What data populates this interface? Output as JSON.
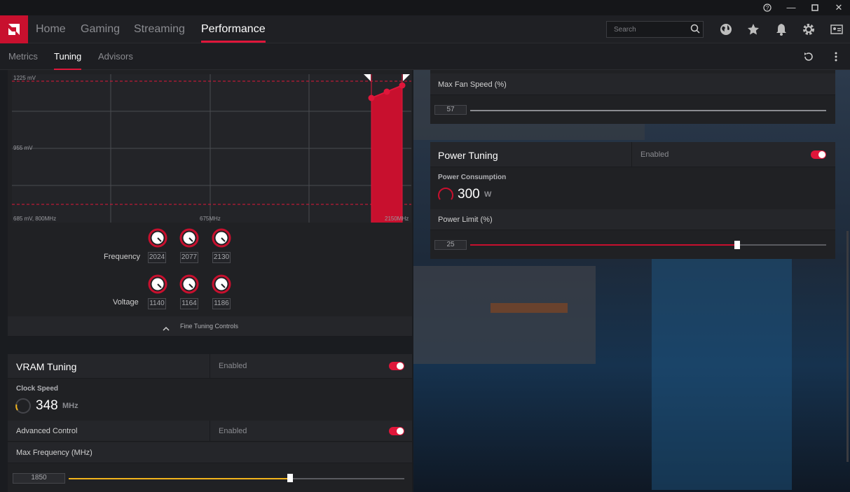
{
  "nav": {
    "tabs": [
      "Home",
      "Gaming",
      "Streaming",
      "Performance"
    ],
    "active": "Performance",
    "search_placeholder": "Search"
  },
  "subnav": {
    "tabs": [
      "Metrics",
      "Tuning",
      "Advisors"
    ],
    "active": "Tuning"
  },
  "gpu_curve": {
    "y_top_label": "1225 mV",
    "y_mid_label": "955 mV",
    "x_left_label": "685 mV, 800MHz",
    "x_mid_label": "675MHz",
    "x_right_label": "2150MHz",
    "frequency_label": "Frequency",
    "voltage_label": "Voltage",
    "frequency_values": [
      "2024",
      "2077",
      "2130"
    ],
    "voltage_values": [
      "1140",
      "1164",
      "1186"
    ],
    "fine_tuning_label": "Fine Tuning Controls"
  },
  "vram": {
    "title": "VRAM Tuning",
    "status": "Enabled",
    "clock_label": "Clock Speed",
    "clock_value": "348",
    "clock_unit": "MHz",
    "advanced_label": "Advanced Control",
    "advanced_status": "Enabled",
    "max_freq_label": "Max Frequency (MHz)",
    "max_freq_value": "1850",
    "max_freq_fraction": 0.66
  },
  "fan": {
    "max_speed_label": "Max Fan Speed (%)",
    "max_speed_value": "57"
  },
  "power": {
    "title": "Power Tuning",
    "status": "Enabled",
    "consumption_label": "Power Consumption",
    "consumption_value": "300",
    "consumption_unit": "W",
    "limit_label": "Power Limit (%)",
    "limit_value": "25",
    "limit_fraction": 0.75
  },
  "colors": {
    "accent": "#e0163a",
    "vram_slider": "#f2b41c"
  }
}
